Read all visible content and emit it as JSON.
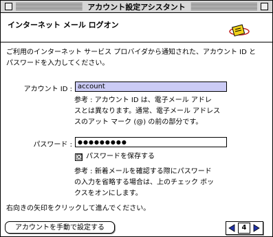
{
  "window": {
    "title": "アカウント設定アシスタント"
  },
  "header": {
    "title": "インターネット メール ログオン"
  },
  "intro": {
    "line1": "ご利用のインターネット サービス プロバイダから通知された、アカウント ID と",
    "line2": "パスワードを入力してください。"
  },
  "account": {
    "label": "アカウント ID :",
    "value": "account",
    "note1": "参考 : アカウント ID は、電子メール アドレ",
    "note2": "スとは異なります。通常、電子メール アドレス",
    "note3": "スのアット マーク (@) の前の部分です。"
  },
  "password": {
    "label": "パスワード :",
    "value": "●●●●●●●●●",
    "save_label": "パスワードを保存する",
    "save_checked": true,
    "checkbox_mark": "☒",
    "note1": "参考 : 新着メールを確認する際にパスワード",
    "note2": "の入力を省略する場合は、上のチェック ボッ",
    "note3": "クスをオンにします。"
  },
  "footer": {
    "instruction": "右向きの矢印をクリックして進んでください。",
    "manual_button": "アカウントを手動で設定する",
    "page_number": "4"
  },
  "colors": {
    "selection": "#cbcbf5",
    "arrow": "#2233aa"
  }
}
